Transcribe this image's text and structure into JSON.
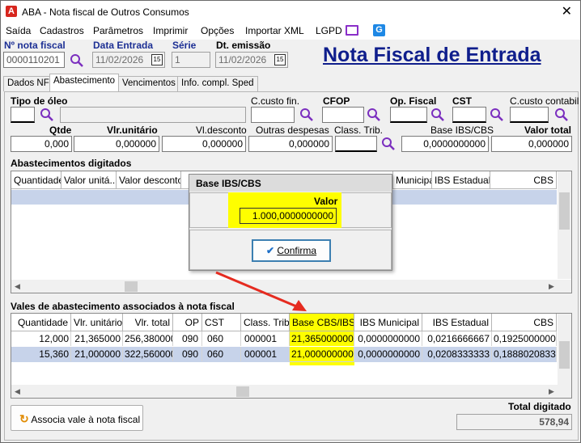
{
  "window": {
    "title": "ABA - Nota fiscal de Outros Consumos",
    "app_icon": "A",
    "close": "✕"
  },
  "menu": [
    "Saída",
    "Cadastros",
    "Parâmetros",
    "Imprimir",
    "Opções",
    "Importar XML",
    "LGPD"
  ],
  "header": {
    "nota_label": "Nº nota fiscal",
    "nota_value": "0000110201",
    "data_entrada_label": "Data Entrada",
    "data_entrada_value": "11/02/2026",
    "serie_label": "Série",
    "serie_value": "1",
    "dt_emissao_label": "Dt. emissão",
    "dt_emissao_value": "11/02/2026",
    "calendar_text": "15",
    "page_heading": "Nota Fiscal de Entrada"
  },
  "tabs": [
    "Dados NF",
    "Abastecimento",
    "Vencimentos",
    "Info. compl. Sped"
  ],
  "form": {
    "tipo_oleo": "Tipo de óleo",
    "c_custo_fin": "C.custo fin.",
    "cfop": "CFOP",
    "op_fiscal": "Op. Fiscal",
    "cst": "CST",
    "c_custo_contabil": "C.custo contabil",
    "qtde": "Qtde",
    "vlr_unitario": "Vlr.unitário",
    "vlr_desconto": "Vl.desconto",
    "outras_despesas": "Outras despesas",
    "class_trib": "Class. Trib.",
    "base_ibs_cbs": "Base IBS/CBS",
    "valor_total": "Valor total",
    "qtde_value": "0,000",
    "vlr_unitario_value": "0,000000",
    "vlr_desconto_value": "0,000000",
    "outras_despesas_value": "0,000000",
    "base_ibs_cbs_value": "0,0000000000",
    "valor_total_value": "0,000000"
  },
  "abastecimentos": {
    "title": "Abastecimentos digitados",
    "columns": [
      "Quantidade",
      "Valor unitá...",
      "Valor desconto",
      "",
      "Municipal",
      "IBS Estadual",
      "CBS"
    ]
  },
  "dialog": {
    "title": "Base IBS/CBS",
    "valor_label": "Valor",
    "valor_value": "1.000,0000000000",
    "confirm_label": "Confirma"
  },
  "vales": {
    "title": "Vales de abastecimento associados à nota fiscal",
    "columns": [
      "Quantidade",
      "Vlr. unitário",
      "Vlr. total",
      "OP",
      "CST",
      "Class. Trib.",
      "Base CBS/IBS",
      "IBS Municipal",
      "IBS Estadual",
      "CBS"
    ],
    "rows": [
      [
        "12,000",
        "21,365000",
        "256,380000",
        "090",
        "060",
        "000001",
        "21,3650000000",
        "0,0000000000",
        "0,0216666667",
        "0,1925000000"
      ],
      [
        "15,360",
        "21,000000",
        "322,560000",
        "090",
        "060",
        "000001",
        "21,0000000000",
        "0,0000000000",
        "0,0208333333",
        "0,1888020833"
      ]
    ]
  },
  "footer": {
    "associa_label": "Associa vale à nota fiscal",
    "total_label": "Total digitado",
    "total_value": "578,94"
  },
  "colors": {
    "highlight": "#fefe00",
    "selected_row": "#c7d3ea",
    "heading": "#0f1e8c",
    "search_icon": "#7b2fbf",
    "annotation_arrow": "#e52b20"
  }
}
